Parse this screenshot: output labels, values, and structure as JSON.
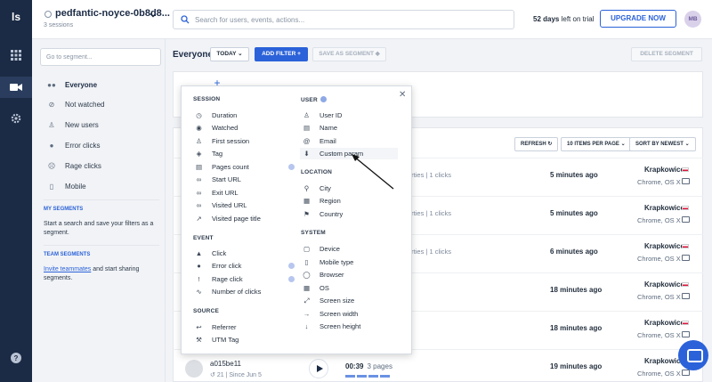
{
  "app": {
    "logo": "ls"
  },
  "topbar": {
    "project_name": "pedfantic-noyce-0b8d8...",
    "project_sub": "3 sessions",
    "search_placeholder": "Search for users, events, actions...",
    "trial_days": "52 days",
    "trial_text": "left on trial",
    "upgrade_label": "UPGRADE NOW",
    "avatar_initials": "MB"
  },
  "segments": {
    "placeholder": "Go to segment...",
    "items": [
      {
        "label": "Everyone",
        "icon": "people-icon"
      },
      {
        "label": "Not watched",
        "icon": "eye-slash-icon"
      },
      {
        "label": "New users",
        "icon": "person-icon"
      },
      {
        "label": "Error clicks",
        "icon": "bomb-icon"
      },
      {
        "label": "Rage clicks",
        "icon": "angry-icon"
      },
      {
        "label": "Mobile",
        "icon": "mobile-icon"
      }
    ],
    "my_segments_heading": "MY SEGMENTS",
    "my_segments_text": "Start a search and save your filters as a segment.",
    "team_segments_heading": "TEAM SEGMENTS",
    "team_link": "Invite teammates",
    "team_text": " and start sharing segments."
  },
  "main": {
    "segment_title": "Everyone",
    "date_filter": "TODAY",
    "add_filter": "ADD FILTER",
    "save_segment": "SAVE AS SEGMENT",
    "delete_segment": "DELETE SEGMENT",
    "refresh": "REFRESH",
    "per_page": "10 ITEMS PER PAGE",
    "sort": "SORT BY NEWEST"
  },
  "rows": [
    {
      "evt": "erties  |  1 clicks",
      "time": "5 minutes ago",
      "city": "Krapkowice",
      "os": "Chrome, OS X"
    },
    {
      "evt": "erties  |  1 clicks",
      "time": "5 minutes ago",
      "city": "Krapkowice",
      "os": "Chrome, OS X"
    },
    {
      "evt": "erties  |  1 clicks",
      "time": "6 minutes ago",
      "city": "Krapkowice",
      "os": "Chrome, OS X"
    },
    {
      "evt": "",
      "time": "18 minutes ago",
      "city": "Krapkowice",
      "os": "Chrome, OS X"
    },
    {
      "evt": "",
      "time": "18 minutes ago",
      "city": "Krapkowice",
      "os": "Chrome, OS X"
    }
  ],
  "last_row": {
    "user_id": "a015be11",
    "meta": "21  |  Since Jun 5",
    "duration": "00:39",
    "pages": "3 pages",
    "time": "19 minutes ago",
    "city": "Krapkowice",
    "os": "Chrome, OS X"
  },
  "dropdown": {
    "session_heading": "SESSION",
    "session_items": [
      "Duration",
      "Watched",
      "First session",
      "Tag",
      "Pages count",
      "Start URL",
      "Exit URL",
      "Visited URL",
      "Visited page title"
    ],
    "event_heading": "EVENT",
    "event_items": [
      "Click",
      "Error click",
      "Rage click",
      "Number of clicks"
    ],
    "source_heading": "SOURCE",
    "source_items": [
      "Referrer",
      "UTM Tag"
    ],
    "user_heading": "USER",
    "user_items": [
      "User ID",
      "Name",
      "Email",
      "Custom param"
    ],
    "location_heading": "LOCATION",
    "location_items": [
      "City",
      "Region",
      "Country"
    ],
    "system_heading": "SYSTEM",
    "system_items": [
      "Device",
      "Mobile type",
      "Browser",
      "OS",
      "Screen size",
      "Screen width",
      "Screen height"
    ]
  }
}
